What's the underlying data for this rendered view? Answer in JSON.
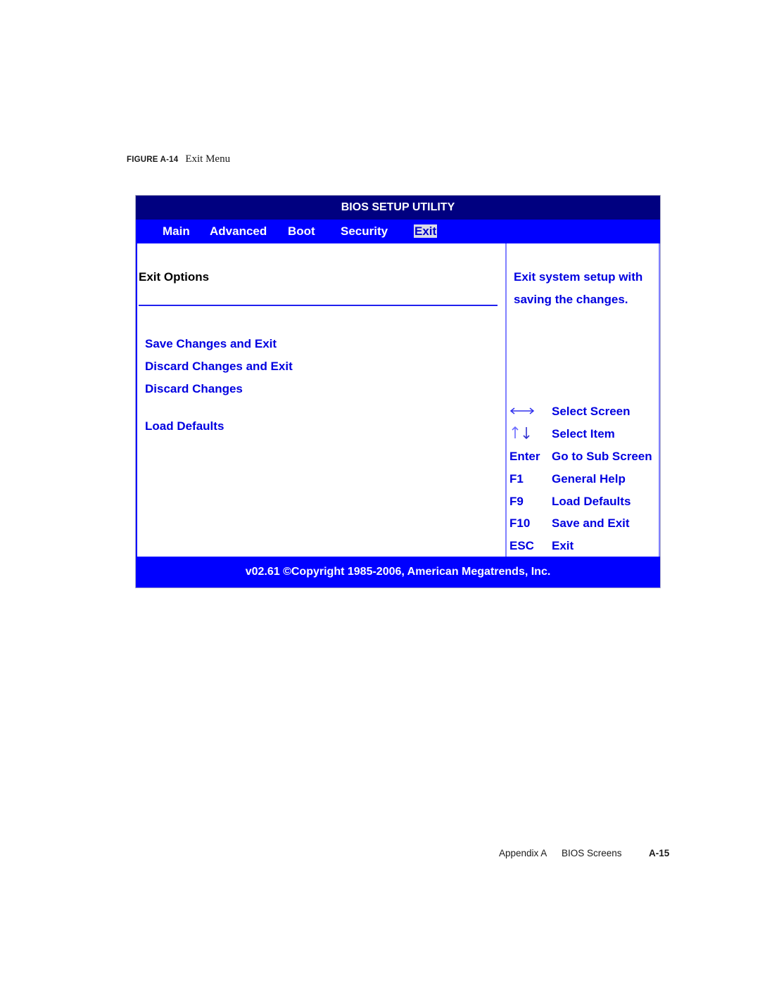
{
  "caption": {
    "figure_label": "FIGURE A-14",
    "title": "Exit Menu"
  },
  "bios": {
    "title": "BIOS SETUP UTILITY",
    "tabs": [
      {
        "label": "Main",
        "active": false
      },
      {
        "label": "Advanced",
        "active": false
      },
      {
        "label": "Boot",
        "active": false
      },
      {
        "label": "Security",
        "active": false
      },
      {
        "label": "Exit",
        "active": true
      }
    ],
    "section_title": "Exit Options",
    "options": [
      {
        "label": "Save Changes and Exit"
      },
      {
        "label": "Discard Changes and Exit"
      },
      {
        "label": "Discard Changes"
      },
      {
        "label": "Load Defaults"
      }
    ],
    "help_text": [
      "Exit system setup with",
      "saving the changes."
    ],
    "key_legend": [
      {
        "key": "left-right-arrows-icon",
        "description": "Select Screen"
      },
      {
        "key": "up-down-arrows-icon",
        "description": "Select Item"
      },
      {
        "key": "Enter",
        "description": "Go to Sub Screen"
      },
      {
        "key": "F1",
        "description": "General Help"
      },
      {
        "key": "F9",
        "description": "Load Defaults"
      },
      {
        "key": "F10",
        "description": "Save and Exit"
      },
      {
        "key": "ESC",
        "description": "Exit"
      }
    ],
    "footer": "v02.61 ©Copyright 1985-2006, American Megatrends, Inc.",
    "colors": {
      "title_bg": "#000080",
      "menu_bg": "#0000ff",
      "text_blue": "#0000e0",
      "divider": "#8080ff"
    }
  },
  "page_footer": {
    "section": "Appendix A",
    "chapter": "BIOS Screens",
    "page": "A-15"
  }
}
